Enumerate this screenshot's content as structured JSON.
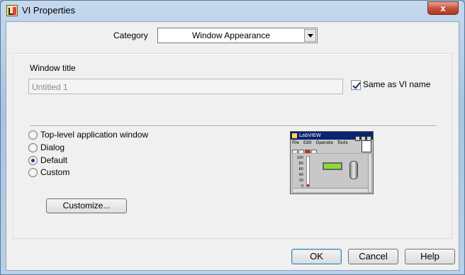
{
  "window": {
    "title": "VI Properties",
    "close_label": "x"
  },
  "category": {
    "label": "Category",
    "selected": "Window Appearance"
  },
  "window_title_section": {
    "label": "Window title",
    "value": "Untitled 1",
    "same_as_vi_name": {
      "label": "Same as VI name",
      "checked": true
    }
  },
  "appearance_options": [
    {
      "label": "Top-level application window",
      "checked": false
    },
    {
      "label": "Dialog",
      "checked": false
    },
    {
      "label": "Default",
      "checked": true
    },
    {
      "label": "Custom",
      "checked": false
    }
  ],
  "customize_button": "Customize...",
  "preview": {
    "title": "LabVIEW",
    "menu": [
      "File",
      "Edit",
      "Operate",
      "Tools"
    ],
    "scale": [
      "100",
      "80",
      "60",
      "40",
      "20",
      "0"
    ]
  },
  "footer": {
    "ok": "OK",
    "cancel": "Cancel",
    "help": "Help"
  },
  "colors": {
    "title_bar": "#a9c4e0",
    "close_button": "#c9523c",
    "dialog_background": "#f0f0f0"
  }
}
